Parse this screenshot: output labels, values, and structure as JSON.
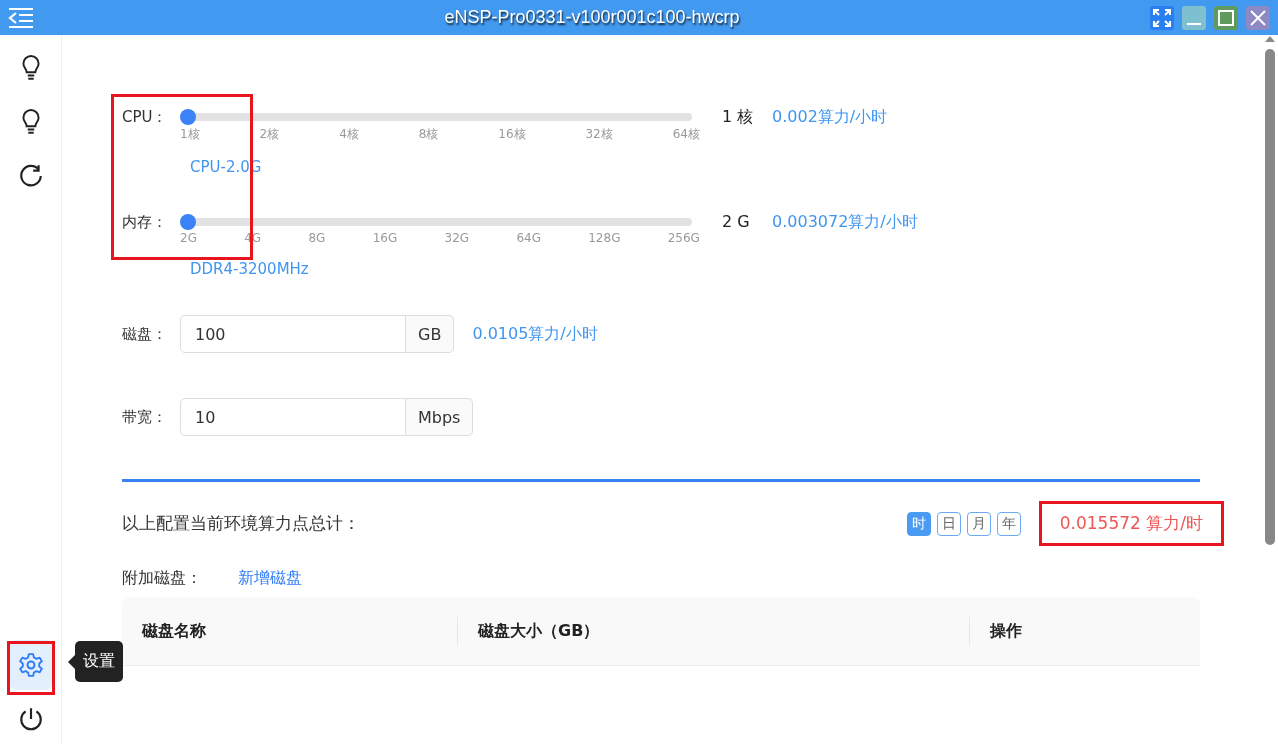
{
  "window": {
    "title": "eNSP-Pro0331-v100r001c100-hwcrp"
  },
  "sidebar": {
    "items": [
      {
        "kind": "bulb",
        "selected": false
      },
      {
        "kind": "bulb",
        "selected": false
      },
      {
        "kind": "refresh",
        "selected": false
      },
      {
        "kind": "settings",
        "selected": true
      },
      {
        "kind": "power",
        "selected": false
      }
    ],
    "tooltip": "设置"
  },
  "sliders": [
    {
      "label": "CPU：",
      "level": 0,
      "ticks": [
        "1核",
        "2核",
        "4核",
        "8核",
        "16核",
        "32核",
        "64核"
      ],
      "value": "1 核",
      "price": "0.002算力/小时",
      "spec": "CPU-2.0G"
    },
    {
      "label": "内存：",
      "level": 0,
      "ticks": [
        "2G",
        "4G",
        "8G",
        "16G",
        "32G",
        "64G",
        "128G",
        "256G"
      ],
      "value": "2 G",
      "price": "0.003072算力/小时",
      "spec": "DDR4-3200MHz"
    }
  ],
  "inputs": [
    {
      "label": "磁盘：",
      "value": "100",
      "unit": "GB",
      "price": "0.0105算力/小时"
    },
    {
      "label": "带宽：",
      "value": "10",
      "unit": "Mbps"
    }
  ],
  "total": {
    "label": "以上配置当前环境算力点总计：",
    "periods": [
      {
        "label": "时",
        "selected": true
      },
      {
        "label": "日",
        "selected": false
      },
      {
        "label": "月",
        "selected": false
      },
      {
        "label": "年",
        "selected": false
      }
    ],
    "amount": "0.015572 算力/时"
  },
  "attached": {
    "label": "附加磁盘：",
    "add_link": "新增磁盘",
    "columns": [
      "磁盘名称",
      "磁盘大小（GB）",
      "操作"
    ]
  }
}
